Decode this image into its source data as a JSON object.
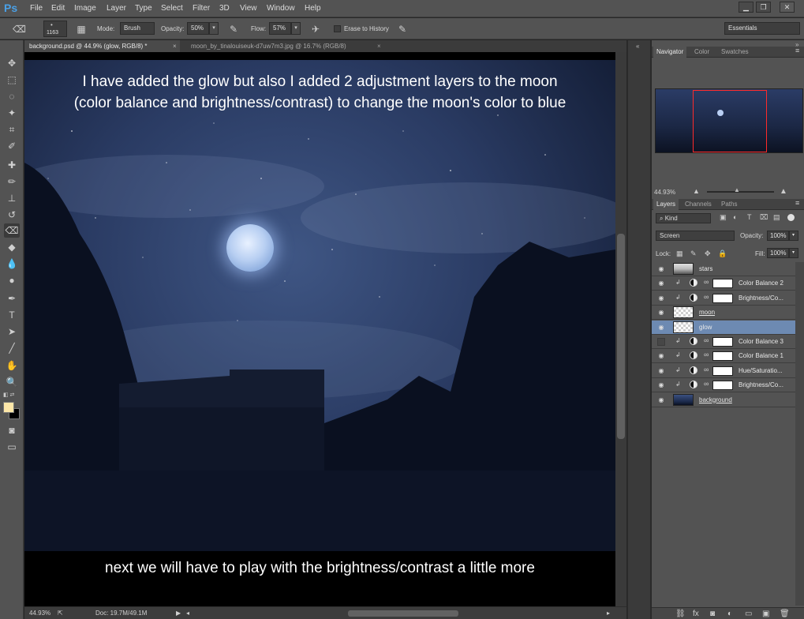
{
  "app": {
    "logo": "Ps"
  },
  "menu": [
    "File",
    "Edit",
    "Image",
    "Layer",
    "Type",
    "Select",
    "Filter",
    "3D",
    "View",
    "Window",
    "Help"
  ],
  "window_controls": {
    "minimize": "▁",
    "restore": "❐",
    "close": "✕"
  },
  "options_bar": {
    "brush_size": "1163",
    "mode_label": "Mode:",
    "mode_value": "Brush",
    "opacity_label": "Opacity:",
    "opacity_value": "50%",
    "flow_label": "Flow:",
    "flow_value": "57%",
    "erase_history_label": "Erase to History",
    "erase_history_checked": false,
    "workspace": "Essentials"
  },
  "tabs": [
    {
      "label": "background.psd @ 44.9% (glow, RGB/8) *",
      "close": "×",
      "active": true
    },
    {
      "label": "moon_by_tinalouiseuk-d7uw7m3.jpg @ 16.7% (RGB/8)",
      "close": "×",
      "active": false
    }
  ],
  "canvas": {
    "top_caption_line1": "I have added the glow but also I added 2 adjustment layers to the moon",
    "top_caption_line2": "(color balance and brightness/contrast) to change the moon's color to blue",
    "bottom_caption": "next we will have to play with the brightness/contrast a little more"
  },
  "status_bar": {
    "zoom": "44.93%",
    "doc": "Doc: 19.7M/49.1M"
  },
  "navigator": {
    "tabs": [
      "Navigator",
      "Color",
      "Swatches"
    ],
    "zoom": "44.93%"
  },
  "layers_panel": {
    "tabs": [
      "Layers",
      "Channels",
      "Paths"
    ],
    "filter_kind": "Kind",
    "blend_mode": "Screen",
    "opacity_label": "Opacity:",
    "opacity_value": "100%",
    "lock_label": "Lock:",
    "fill_label": "Fill:",
    "fill_value": "100%",
    "layers": [
      {
        "name": "stars",
        "type": "pixel",
        "visible": true,
        "selected": false
      },
      {
        "name": "Color Balance 2",
        "type": "adjustment",
        "visible": true,
        "selected": false
      },
      {
        "name": "Brightness/Co...",
        "type": "adjustment",
        "visible": true,
        "selected": false
      },
      {
        "name": "moon",
        "type": "pixel",
        "visible": true,
        "selected": false
      },
      {
        "name": "glow",
        "type": "pixel",
        "visible": true,
        "selected": true
      },
      {
        "name": "Color Balance 3",
        "type": "adjustment",
        "visible": false,
        "selected": false
      },
      {
        "name": "Color Balance 1",
        "type": "adjustment",
        "visible": true,
        "selected": false
      },
      {
        "name": "Hue/Saturatio...",
        "type": "adjustment",
        "visible": true,
        "selected": false
      },
      {
        "name": "Brightness/Co...",
        "type": "adjustment",
        "visible": true,
        "selected": false
      },
      {
        "name": "background",
        "type": "photo",
        "visible": true,
        "selected": false
      }
    ]
  },
  "colors": {
    "foreground": "#fde7a8",
    "background": "#000000",
    "selection": "#6d8ab2"
  }
}
